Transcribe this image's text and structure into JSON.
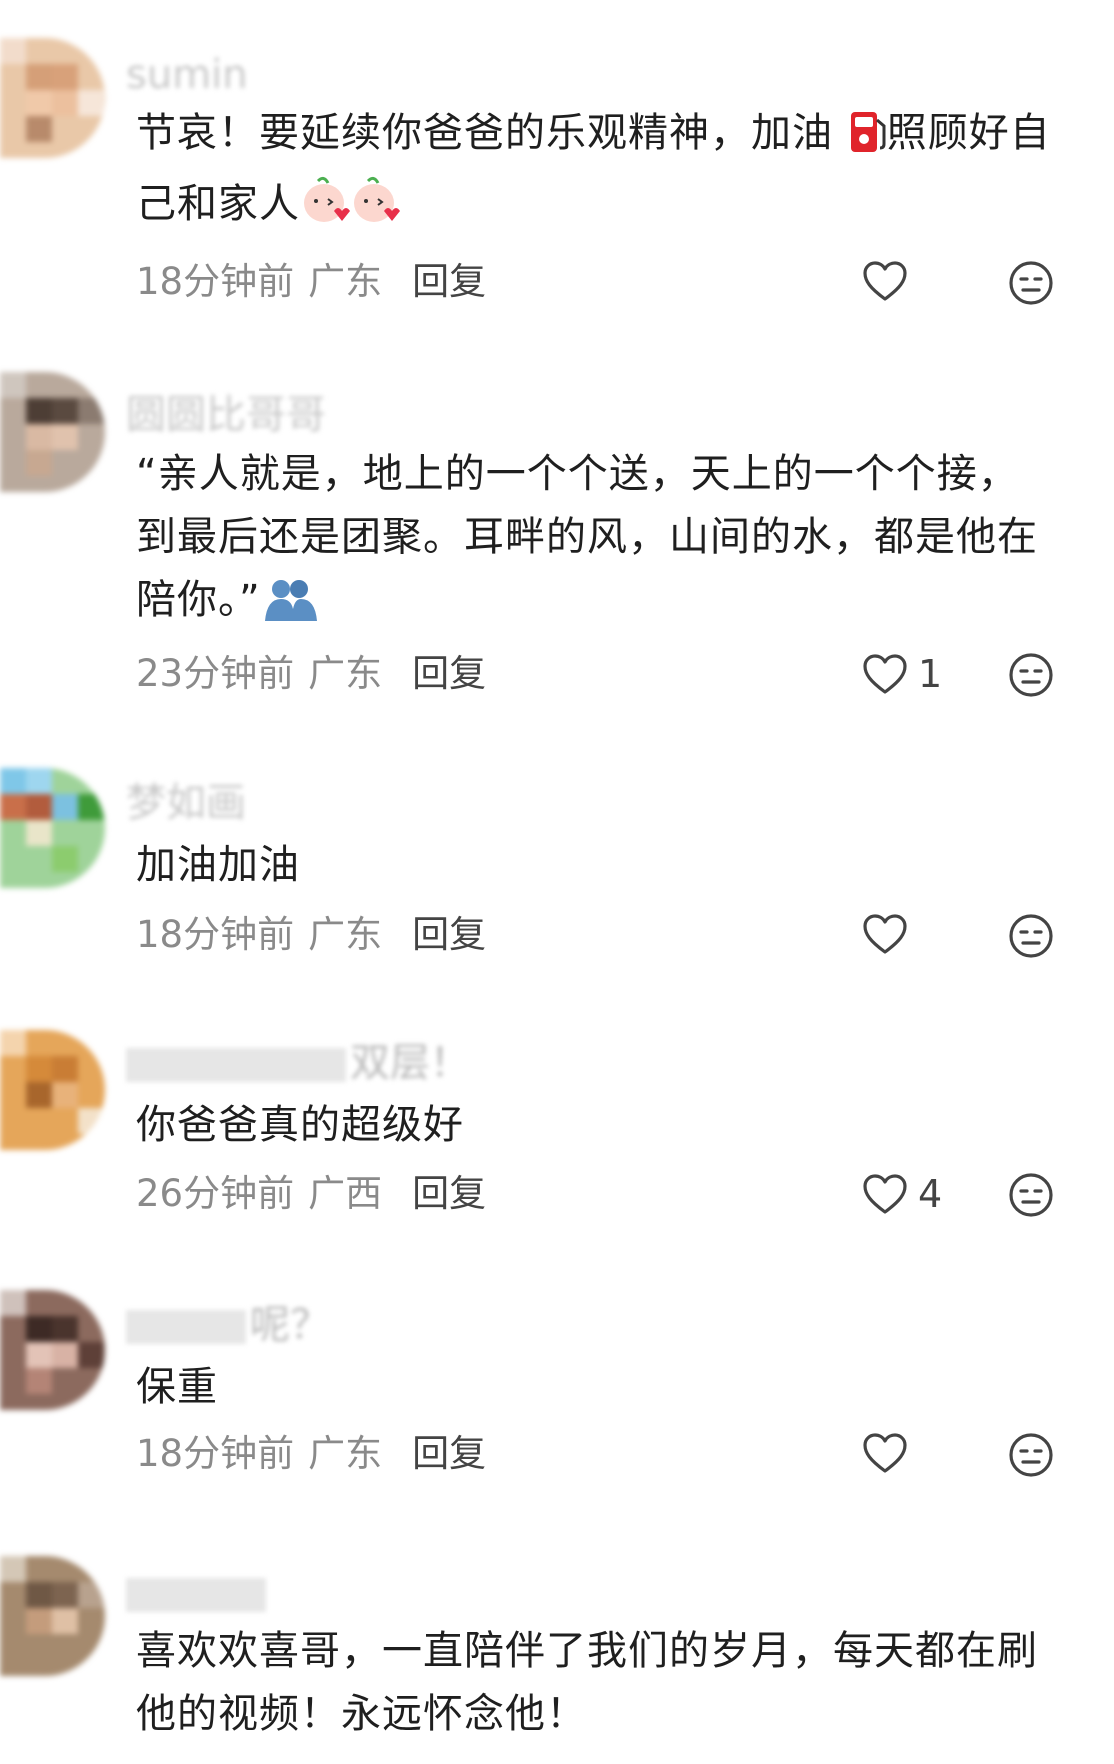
{
  "comments": [
    {
      "username": "sumin",
      "text_before_emoji": "节哀！要延续你爸爸的乐观精神，加油 ",
      "text_after_emoji": "照顾好自己和家人",
      "time": "18分钟前",
      "region": "广东",
      "reply": "回复",
      "likes": ""
    },
    {
      "username": "圆圆比哥哥",
      "text": "“亲人就是，地上的一个个送，天上的一个个接，到最后还是团聚。耳畔的风，山间的水，都是他在陪你。”",
      "time": "23分钟前",
      "region": "广东",
      "reply": "回复",
      "likes": "1"
    },
    {
      "username": "梦如画",
      "text": "加油加油",
      "time": "18分钟前",
      "region": "广东",
      "reply": "回复",
      "likes": ""
    },
    {
      "username_tail": "双层！",
      "text": "你爸爸真的超级好",
      "time": "26分钟前",
      "region": "广西",
      "reply": "回复",
      "likes": "4"
    },
    {
      "username_tail": "呢？",
      "text": "保重",
      "time": "18分钟前",
      "region": "广东",
      "reply": "回复",
      "likes": ""
    },
    {
      "text": "喜欢欢喜哥，一直陪伴了我们的岁月，每天都在刷他的视频！永远怀念他！"
    }
  ]
}
